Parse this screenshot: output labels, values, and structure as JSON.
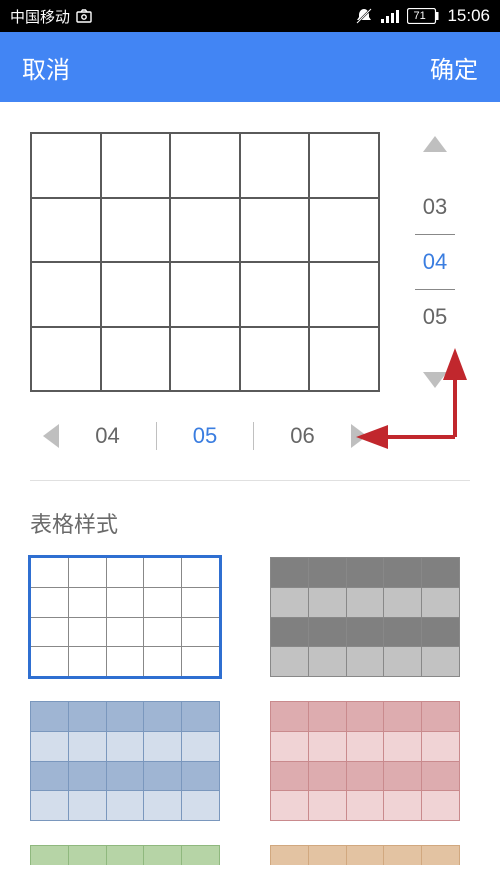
{
  "status": {
    "carrier": "中国移动",
    "battery": "71",
    "time": "15:06"
  },
  "header": {
    "cancel": "取消",
    "confirm": "确定"
  },
  "row_picker": {
    "prev": "03",
    "selected": "04",
    "next": "05"
  },
  "col_picker": {
    "prev": "04",
    "selected": "05",
    "next": "06"
  },
  "section_title": "表格样式"
}
